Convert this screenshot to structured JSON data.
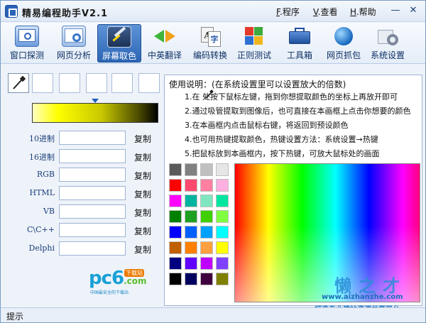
{
  "app": {
    "title": "精易编程助手V2.1"
  },
  "menu": [
    {
      "key": "F",
      "label": "程序"
    },
    {
      "key": "V",
      "label": "查看"
    },
    {
      "key": "H",
      "label": "帮助"
    }
  ],
  "window_buttons": {
    "minimize": "—",
    "close": "✕"
  },
  "toolbar": [
    {
      "label": "窗口探测",
      "icon": "window-probe-icon"
    },
    {
      "label": "网页分析",
      "icon": "web-analysis-icon"
    },
    {
      "label": "屏幕取色",
      "icon": "screen-color-picker-icon",
      "active": true
    },
    {
      "label": "中英翻译",
      "icon": "translate-icon"
    },
    {
      "label": "编码转换",
      "icon": "encoding-convert-icon"
    },
    {
      "label": "正则测试",
      "icon": "regex-test-icon"
    },
    {
      "label": "工具箱",
      "icon": "toolbox-icon"
    },
    {
      "label": "网页抓包",
      "icon": "packet-capture-icon"
    },
    {
      "label": "系统设置",
      "icon": "settings-icon"
    }
  ],
  "color_fields": [
    {
      "label": "10进制",
      "value": "",
      "button": "复制"
    },
    {
      "label": "16进制",
      "value": "",
      "button": "复制"
    },
    {
      "label": "RGB",
      "value": "",
      "button": "复制"
    },
    {
      "label": "HTML",
      "value": "",
      "button": "复制"
    },
    {
      "label": "VB",
      "value": "",
      "button": "复制"
    },
    {
      "label": "C\\C++",
      "value": "",
      "button": "复制"
    },
    {
      "label": "Delphi",
      "value": "",
      "button": "复制"
    }
  ],
  "gradient": {
    "marker_fraction": 0.5
  },
  "usage": {
    "title": "使用说明：(在系统设置里可以设置放大的倍数)",
    "lines": [
      "1.在   处按下鼠标左键，拖到你想提取颜色的坐标上再放开即可",
      "2.通过吸管提取到图像后，也可直接在本画框上点击你想要的颜色",
      "3.在本画框内点击鼠标右键，将返回到预设颜色",
      "4.也可用热键提取颜色，热键设置方法：系统设置→热键",
      "5.把鼠标放到本画框内，按下热键，可放大鼠标处的画面"
    ]
  },
  "palette": [
    "#5a5a5a",
    "#808080",
    "#c0c0c0",
    "#e6e6e6",
    "#ff0000",
    "#ff4a6e",
    "#ff80a0",
    "#ffb0e0",
    "#ff00ff",
    "#00b4a0",
    "#80e6c0",
    "#00e6a0",
    "#008000",
    "#20a020",
    "#40d000",
    "#80ff40",
    "#0000ff",
    "#0060ff",
    "#00a0ff",
    "#00ffff",
    "#c06000",
    "#ff8000",
    "#ffa040",
    "#ffff00",
    "#000080",
    "#6000ff",
    "#c000ff",
    "#8040ff",
    "#000000",
    "#000060",
    "#400040",
    "#808000"
  ],
  "logo": {
    "text": "pc6",
    "suffix": ".com",
    "badge": "下载站",
    "sub": "中国最安全的下载站"
  },
  "status": {
    "text": "提示"
  },
  "watermark": {
    "main": "懒之才",
    "url": "www.aizhanzhe.com",
    "sub": "打造专业建站资源共享平台"
  }
}
